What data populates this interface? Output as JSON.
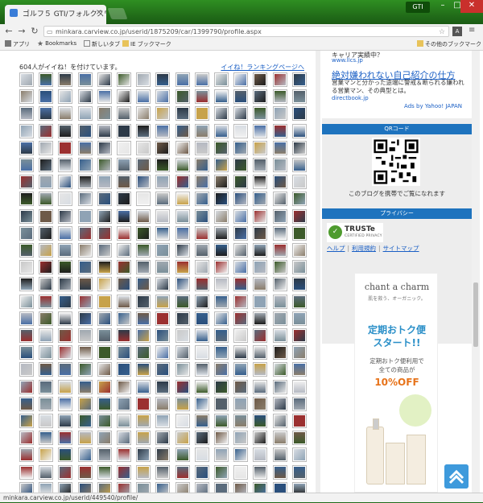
{
  "browser": {
    "tab_title": "ゴルフ５ GTI/フォルクスワー",
    "tab_close": "×",
    "user_badge": "GTI",
    "url": "minkara.carview.co.jp/userid/1875209/car/1399790/profile.aspx",
    "status_url": "minkara.carview.co.jp/userid/449540/profile/"
  },
  "bookmarks": {
    "apps": "アプリ",
    "bookmarks": "Bookmarks",
    "new_tab": "新しいタブ",
    "ie_bookmarks": "IE ブックマーク",
    "other": "その他のブックマーク"
  },
  "likes": {
    "count_text": "604人がイイね！を付けています。",
    "ranking_link": "イイね！ランキングページへ"
  },
  "ads": {
    "ad1_text": "キャリア実績中？",
    "ad1_url": "www.llcs.jp",
    "ad2_title": "絶対嫌われない自己紹介の仕方",
    "ad2_desc": "営業マンと分かった途端に警戒＆断られる嫌われる営業マン、その典型とは。",
    "ad2_url": "directbook.jp",
    "ads_by": "Ads by Yahoo! JAPAN"
  },
  "qr": {
    "header": "QRコード",
    "caption": "このブログを携帯でご覧になれます"
  },
  "privacy": {
    "header": "プライバシー",
    "truste_name": "TRUSTe",
    "truste_sub": "CERTIFIED PRIVACY",
    "links": [
      "ヘルプ",
      "利用規約",
      "サイトマップ"
    ]
  },
  "banner": {
    "logo": "chant a charm",
    "tagline": "肌を救う、オーガニック。",
    "headline1": "定期おトク便",
    "headline2": "スタート!!",
    "sub1": "定期おトク便利用で",
    "sub2": "全ての商品が",
    "discount": "10%OFF"
  },
  "colors": {
    "accent_blue": "#1e73be",
    "link_blue": "#1a5fc5",
    "browser_green": "#1f6b1a"
  },
  "icons": [
    "back-icon",
    "forward-icon",
    "reload-icon",
    "lock-icon",
    "star-icon",
    "menu-icon",
    "back-to-top-icon"
  ]
}
